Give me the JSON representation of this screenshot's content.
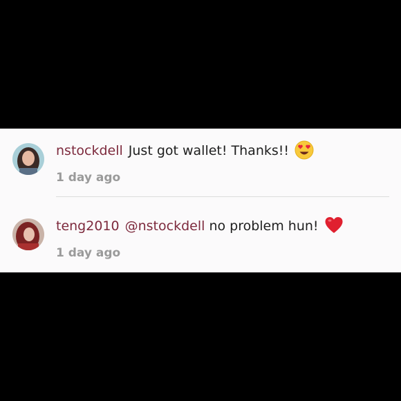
{
  "comments": [
    {
      "username": "nstockdell",
      "text": "Just got wallet! Thanks!!",
      "emoji": "heart-eyes-emoji",
      "timestamp": "1 day ago"
    },
    {
      "username": "teng2010",
      "mention": "@nstockdell",
      "text": "no problem hun!",
      "emoji": "red-heart-emoji",
      "timestamp": "1 day ago"
    }
  ],
  "colors": {
    "username": "#7d2a3d",
    "timestamp": "#9a9a9a",
    "background": "#fbfafb"
  }
}
